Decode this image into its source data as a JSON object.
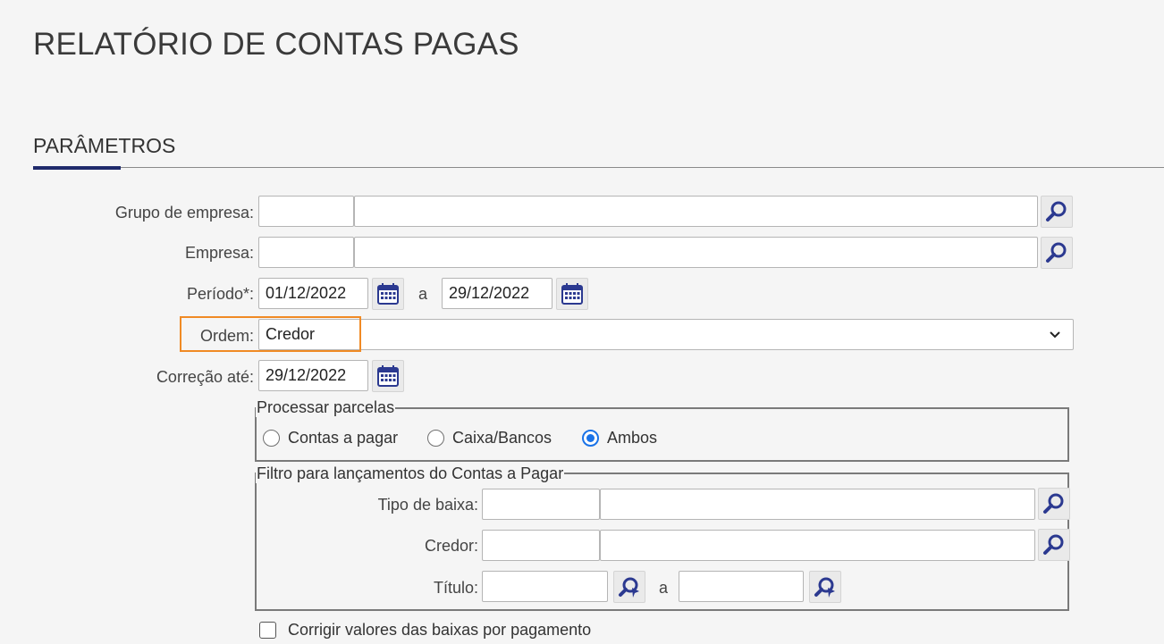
{
  "page": {
    "title": "RELATÓRIO DE CONTAS PAGAS",
    "section_title": "PARÂMETROS"
  },
  "form": {
    "grupo_empresa": {
      "label": "Grupo de empresa:",
      "code": "",
      "name": ""
    },
    "empresa": {
      "label": "Empresa:",
      "code": "",
      "name": ""
    },
    "periodo": {
      "label": "Período*:",
      "start": "01/12/2022",
      "sep": "a",
      "end": "29/12/2022"
    },
    "ordem": {
      "label": "Ordem:",
      "value": "Credor"
    },
    "correcao": {
      "label": "Correção até:",
      "value": "29/12/2022"
    },
    "processar": {
      "legend": "Processar parcelas",
      "options": [
        {
          "label": "Contas a pagar",
          "selected": false
        },
        {
          "label": "Caixa/Bancos",
          "selected": false
        },
        {
          "label": "Ambos",
          "selected": true
        }
      ]
    },
    "filtro": {
      "legend": "Filtro para lançamentos do Contas a Pagar",
      "tipo_baixa": {
        "label": "Tipo de baixa:",
        "code": "",
        "name": ""
      },
      "credor": {
        "label": "Credor:",
        "code": "",
        "name": ""
      },
      "titulo": {
        "label": "Título:",
        "start": "",
        "sep": "a",
        "end": ""
      }
    },
    "corrigir": {
      "label": "Corrigir valores das baixas por pagamento",
      "checked": false
    }
  },
  "colors": {
    "accent": "#1f2a6b",
    "highlight": "#f08a24",
    "radio": "#1a73e8",
    "icon": "#2b3990"
  },
  "icons": {
    "lookup": "magnifier-icon",
    "calendar": "calendar-icon",
    "dropdown": "chevron-down-icon",
    "search_arrow": "search-arrow-icon"
  }
}
